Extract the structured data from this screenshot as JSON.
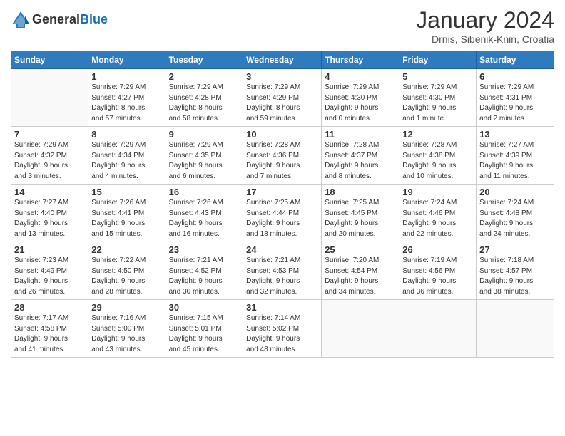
{
  "header": {
    "logo_general": "General",
    "logo_blue": "Blue",
    "month_year": "January 2024",
    "location": "Drnis, Sibenik-Knin, Croatia"
  },
  "weekdays": [
    "Sunday",
    "Monday",
    "Tuesday",
    "Wednesday",
    "Thursday",
    "Friday",
    "Saturday"
  ],
  "weeks": [
    [
      {
        "day": "",
        "info": ""
      },
      {
        "day": "1",
        "info": "Sunrise: 7:29 AM\nSunset: 4:27 PM\nDaylight: 8 hours\nand 57 minutes."
      },
      {
        "day": "2",
        "info": "Sunrise: 7:29 AM\nSunset: 4:28 PM\nDaylight: 8 hours\nand 58 minutes."
      },
      {
        "day": "3",
        "info": "Sunrise: 7:29 AM\nSunset: 4:29 PM\nDaylight: 8 hours\nand 59 minutes."
      },
      {
        "day": "4",
        "info": "Sunrise: 7:29 AM\nSunset: 4:30 PM\nDaylight: 9 hours\nand 0 minutes."
      },
      {
        "day": "5",
        "info": "Sunrise: 7:29 AM\nSunset: 4:30 PM\nDaylight: 9 hours\nand 1 minute."
      },
      {
        "day": "6",
        "info": "Sunrise: 7:29 AM\nSunset: 4:31 PM\nDaylight: 9 hours\nand 2 minutes."
      }
    ],
    [
      {
        "day": "7",
        "info": "Sunrise: 7:29 AM\nSunset: 4:32 PM\nDaylight: 9 hours\nand 3 minutes."
      },
      {
        "day": "8",
        "info": "Sunrise: 7:29 AM\nSunset: 4:34 PM\nDaylight: 9 hours\nand 4 minutes."
      },
      {
        "day": "9",
        "info": "Sunrise: 7:29 AM\nSunset: 4:35 PM\nDaylight: 9 hours\nand 6 minutes."
      },
      {
        "day": "10",
        "info": "Sunrise: 7:28 AM\nSunset: 4:36 PM\nDaylight: 9 hours\nand 7 minutes."
      },
      {
        "day": "11",
        "info": "Sunrise: 7:28 AM\nSunset: 4:37 PM\nDaylight: 9 hours\nand 8 minutes."
      },
      {
        "day": "12",
        "info": "Sunrise: 7:28 AM\nSunset: 4:38 PM\nDaylight: 9 hours\nand 10 minutes."
      },
      {
        "day": "13",
        "info": "Sunrise: 7:27 AM\nSunset: 4:39 PM\nDaylight: 9 hours\nand 11 minutes."
      }
    ],
    [
      {
        "day": "14",
        "info": "Sunrise: 7:27 AM\nSunset: 4:40 PM\nDaylight: 9 hours\nand 13 minutes."
      },
      {
        "day": "15",
        "info": "Sunrise: 7:26 AM\nSunset: 4:41 PM\nDaylight: 9 hours\nand 15 minutes."
      },
      {
        "day": "16",
        "info": "Sunrise: 7:26 AM\nSunset: 4:43 PM\nDaylight: 9 hours\nand 16 minutes."
      },
      {
        "day": "17",
        "info": "Sunrise: 7:25 AM\nSunset: 4:44 PM\nDaylight: 9 hours\nand 18 minutes."
      },
      {
        "day": "18",
        "info": "Sunrise: 7:25 AM\nSunset: 4:45 PM\nDaylight: 9 hours\nand 20 minutes."
      },
      {
        "day": "19",
        "info": "Sunrise: 7:24 AM\nSunset: 4:46 PM\nDaylight: 9 hours\nand 22 minutes."
      },
      {
        "day": "20",
        "info": "Sunrise: 7:24 AM\nSunset: 4:48 PM\nDaylight: 9 hours\nand 24 minutes."
      }
    ],
    [
      {
        "day": "21",
        "info": "Sunrise: 7:23 AM\nSunset: 4:49 PM\nDaylight: 9 hours\nand 26 minutes."
      },
      {
        "day": "22",
        "info": "Sunrise: 7:22 AM\nSunset: 4:50 PM\nDaylight: 9 hours\nand 28 minutes."
      },
      {
        "day": "23",
        "info": "Sunrise: 7:21 AM\nSunset: 4:52 PM\nDaylight: 9 hours\nand 30 minutes."
      },
      {
        "day": "24",
        "info": "Sunrise: 7:21 AM\nSunset: 4:53 PM\nDaylight: 9 hours\nand 32 minutes."
      },
      {
        "day": "25",
        "info": "Sunrise: 7:20 AM\nSunset: 4:54 PM\nDaylight: 9 hours\nand 34 minutes."
      },
      {
        "day": "26",
        "info": "Sunrise: 7:19 AM\nSunset: 4:56 PM\nDaylight: 9 hours\nand 36 minutes."
      },
      {
        "day": "27",
        "info": "Sunrise: 7:18 AM\nSunset: 4:57 PM\nDaylight: 9 hours\nand 38 minutes."
      }
    ],
    [
      {
        "day": "28",
        "info": "Sunrise: 7:17 AM\nSunset: 4:58 PM\nDaylight: 9 hours\nand 41 minutes."
      },
      {
        "day": "29",
        "info": "Sunrise: 7:16 AM\nSunset: 5:00 PM\nDaylight: 9 hours\nand 43 minutes."
      },
      {
        "day": "30",
        "info": "Sunrise: 7:15 AM\nSunset: 5:01 PM\nDaylight: 9 hours\nand 45 minutes."
      },
      {
        "day": "31",
        "info": "Sunrise: 7:14 AM\nSunset: 5:02 PM\nDaylight: 9 hours\nand 48 minutes."
      },
      {
        "day": "",
        "info": ""
      },
      {
        "day": "",
        "info": ""
      },
      {
        "day": "",
        "info": ""
      }
    ]
  ]
}
